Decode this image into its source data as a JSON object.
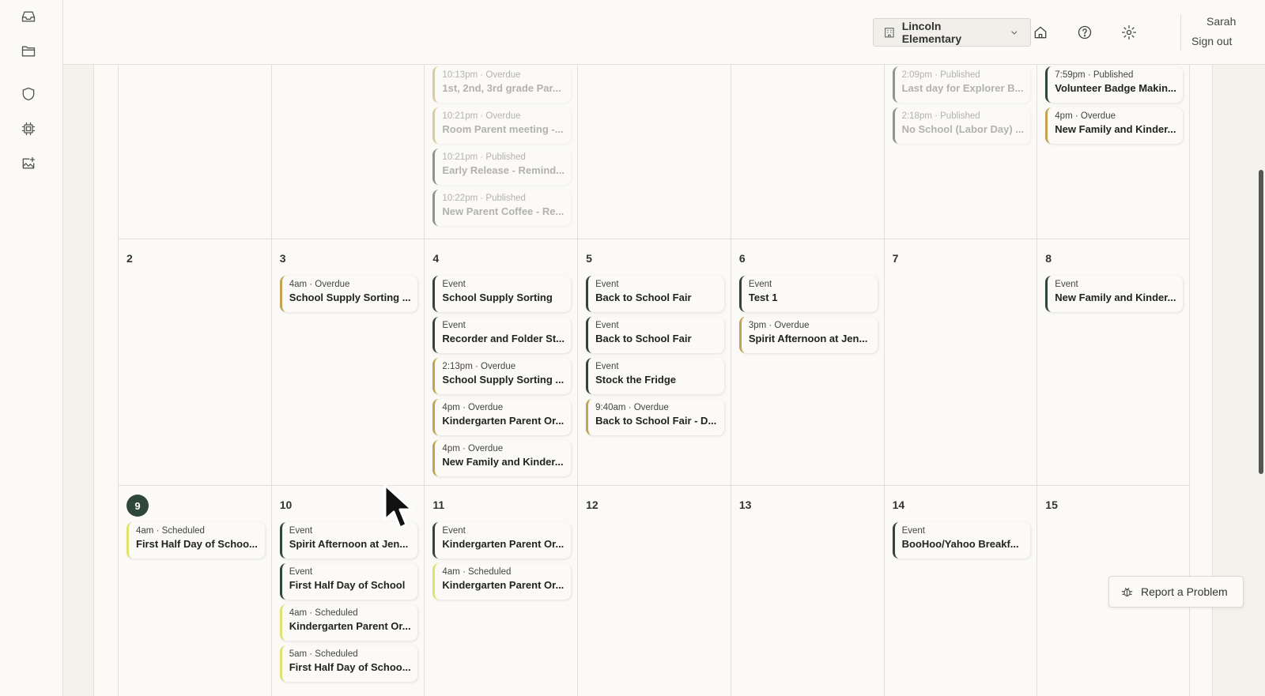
{
  "header": {
    "school": "Lincoln Elementary",
    "user_name": "Sarah",
    "sign_out": "Sign out"
  },
  "icons": {
    "rail": [
      "inbox-icon",
      "folder-icon",
      "shield-icon",
      "chip-icon",
      "image-add-icon"
    ],
    "header": [
      "building-icon",
      "chevron-down-icon",
      "home-icon",
      "help-icon",
      "gear-icon"
    ],
    "report": "bug-icon"
  },
  "colors": {
    "event": "#2f463a",
    "overdue": "#c1a352",
    "scheduled": "#dfe26d",
    "today": "#2f463a"
  },
  "calendar": {
    "weeks": [
      {
        "days": [
          {
            "num": "",
            "items": []
          },
          {
            "num": "",
            "items": []
          },
          {
            "num": "",
            "items": [
              {
                "meta": "10:13pm · Overdue",
                "title": "1st, 2nd, 3rd grade Par...",
                "status": "overdue",
                "faded": true
              },
              {
                "meta": "10:21pm · Overdue",
                "title": "Room Parent meeting -...",
                "status": "overdue",
                "faded": true
              },
              {
                "meta": "10:21pm · Published",
                "title": "Early Release - Remind...",
                "status": "published",
                "faded": true
              },
              {
                "meta": "10:22pm · Published",
                "title": "New Parent Coffee - Re...",
                "status": "published",
                "faded": true
              }
            ]
          },
          {
            "num": "",
            "items": []
          },
          {
            "num": "",
            "items": []
          },
          {
            "num": "",
            "items": [
              {
                "meta": "2:09pm · Published",
                "title": "Last day for Explorer B...",
                "status": "published",
                "faded": true
              },
              {
                "meta": "2:18pm · Published",
                "title": "No School (Labor Day) ...",
                "status": "published",
                "faded": true
              }
            ]
          },
          {
            "num": "",
            "items": [
              {
                "meta": "7:59pm · Published",
                "title": "Volunteer Badge Makin...",
                "status": "published",
                "faded": false
              },
              {
                "meta": "4pm · Overdue",
                "title": "New Family and Kinder...",
                "status": "overdue",
                "faded": false
              }
            ]
          }
        ]
      },
      {
        "days": [
          {
            "num": "2",
            "items": []
          },
          {
            "num": "3",
            "items": [
              {
                "meta": "4am · Overdue",
                "title": "School Supply Sorting ...",
                "status": "overdue"
              }
            ]
          },
          {
            "num": "4",
            "items": [
              {
                "meta": "Event",
                "title": "School Supply Sorting",
                "status": "event"
              },
              {
                "meta": "Event",
                "title": "Recorder and Folder St...",
                "status": "event"
              },
              {
                "meta": "2:13pm · Overdue",
                "title": "School Supply Sorting ...",
                "status": "overdue"
              },
              {
                "meta": "4pm · Overdue",
                "title": "Kindergarten Parent Or...",
                "status": "overdue"
              },
              {
                "meta": "4pm · Overdue",
                "title": "New Family and Kinder...",
                "status": "overdue"
              }
            ]
          },
          {
            "num": "5",
            "items": [
              {
                "meta": "Event",
                "title": "Back to School Fair",
                "status": "event"
              },
              {
                "meta": "Event",
                "title": "Back to School Fair",
                "status": "event"
              },
              {
                "meta": "Event",
                "title": "Stock the Fridge",
                "status": "event"
              },
              {
                "meta": "9:40am · Overdue",
                "title": "Back to School Fair - D...",
                "status": "overdue"
              }
            ]
          },
          {
            "num": "6",
            "items": [
              {
                "meta": "Event",
                "title": "Test 1",
                "status": "event"
              },
              {
                "meta": "3pm · Overdue",
                "title": "Spirit Afternoon at Jen...",
                "status": "overdue"
              }
            ]
          },
          {
            "num": "7",
            "items": []
          },
          {
            "num": "8",
            "items": [
              {
                "meta": "Event",
                "title": "New Family and Kinder...",
                "status": "event"
              }
            ]
          }
        ]
      },
      {
        "days": [
          {
            "num": "9",
            "today": true,
            "items": [
              {
                "meta": "4am · Scheduled",
                "title": "First Half Day of Schoo...",
                "status": "scheduled"
              }
            ]
          },
          {
            "num": "10",
            "items": [
              {
                "meta": "Event",
                "title": "Spirit Afternoon at Jen...",
                "status": "event"
              },
              {
                "meta": "Event",
                "title": "First Half Day of School",
                "status": "event"
              },
              {
                "meta": "4am · Scheduled",
                "title": "Kindergarten Parent Or...",
                "status": "scheduled"
              },
              {
                "meta": "5am · Scheduled",
                "title": "First Half Day of Schoo...",
                "status": "scheduled"
              }
            ]
          },
          {
            "num": "11",
            "items": [
              {
                "meta": "Event",
                "title": "Kindergarten Parent Or...",
                "status": "event"
              },
              {
                "meta": "4am · Scheduled",
                "title": "Kindergarten Parent Or...",
                "status": "scheduled"
              }
            ]
          },
          {
            "num": "12",
            "items": []
          },
          {
            "num": "13",
            "items": []
          },
          {
            "num": "14",
            "items": [
              {
                "meta": "Event",
                "title": "BooHoo/Yahoo Breakf...",
                "status": "event"
              }
            ]
          },
          {
            "num": "15",
            "items": []
          }
        ]
      }
    ]
  },
  "report_button": {
    "label": "Report a Problem"
  }
}
